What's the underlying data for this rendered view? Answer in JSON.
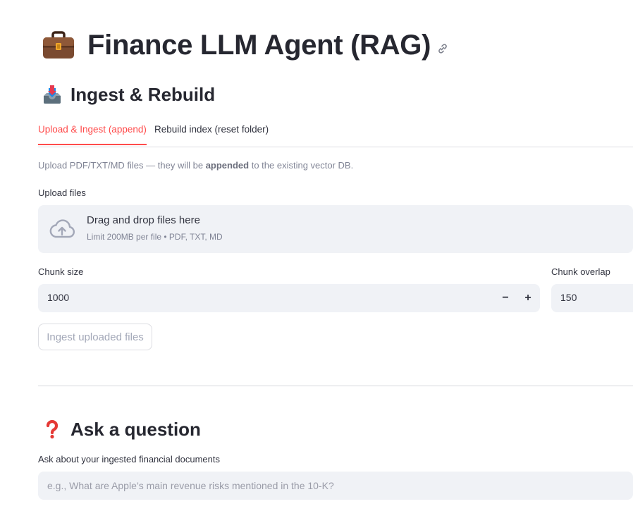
{
  "header": {
    "title": "Finance LLM Agent (RAG)",
    "title_icon": "briefcase-icon",
    "anchor_icon": "link-icon"
  },
  "ingest": {
    "heading": "Ingest & Rebuild",
    "heading_icon": "inbox-tray-icon",
    "tabs": [
      {
        "label": "Upload & Ingest (append)",
        "active": true
      },
      {
        "label": "Rebuild index (reset folder)",
        "active": false
      }
    ],
    "caption_prefix": "Upload PDF/TXT/MD files — they will be ",
    "caption_bold": "appended",
    "caption_suffix": " to the existing vector DB.",
    "upload_label": "Upload files",
    "dropzone": {
      "icon": "cloud-upload-icon",
      "title": "Drag and drop files here",
      "subtitle": "Limit 200MB per file • PDF, TXT, MD"
    },
    "chunk_size": {
      "label": "Chunk size",
      "value": "1000",
      "minus": "−",
      "plus": "+"
    },
    "chunk_overlap": {
      "label": "Chunk overlap",
      "value": "150"
    },
    "ingest_button": "Ingest uploaded files"
  },
  "ask": {
    "heading": "Ask a question",
    "heading_icon": "question-mark-icon",
    "input_label": "Ask about your ingested financial documents",
    "input_placeholder": "e.g., What are Apple’s main revenue risks mentioned in the 10-K?",
    "input_value": ""
  },
  "colors": {
    "accent": "#ff4b4b",
    "input_bg": "#f0f2f6",
    "text": "#31333f",
    "muted": "#808495"
  }
}
